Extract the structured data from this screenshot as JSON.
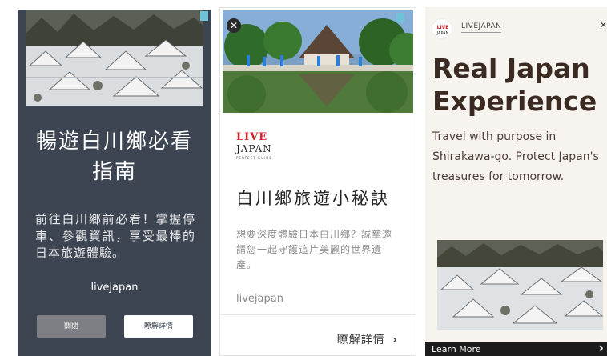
{
  "ad1": {
    "title_line1": "暢遊白川鄉必看",
    "title_line2": "指南",
    "description": "前往白川鄉前必看！掌握停車、參觀資訊，享受最棒的日本旅遊體驗。",
    "brand": "livejapan",
    "close_button": "關閉",
    "more_button": "瞭解詳情",
    "icons": {
      "adchoices": "adchoices-icon"
    },
    "colors": {
      "background": "#3d4553",
      "button_dark": "#7d7f84"
    }
  },
  "ad2": {
    "logo_line1": "LIVE",
    "logo_line2": "JAPAN",
    "logo_tagline": "PERFECT GUIDE",
    "title": "白川鄉旅遊小秘訣",
    "description": "想要深度體驗日本白川鄉？誠摯邀請您一起守護這片美麗的世界遺產。",
    "brand": "livejapan",
    "cta": "瞭解詳情",
    "cta_icon": "chevron-right-icon",
    "icons": {
      "close": "close-icon",
      "adchoices": "adchoices-icon"
    },
    "colors": {
      "logo_red": "#d2232a"
    }
  },
  "ad3": {
    "logo_text": "LIVEJAPAN",
    "headline": "Real Japan Experience",
    "body": "Travel with purpose in Shirakawa-go. Protect Japan's treasures for tomorrow.",
    "learn_more": "Learn More",
    "icons": {
      "close": "close-icon",
      "chevron": "chevron-right-icon"
    },
    "colors": {
      "background": "#f7f3ee",
      "headline": "#3a2a22",
      "bar": "#1c1c1c"
    }
  }
}
